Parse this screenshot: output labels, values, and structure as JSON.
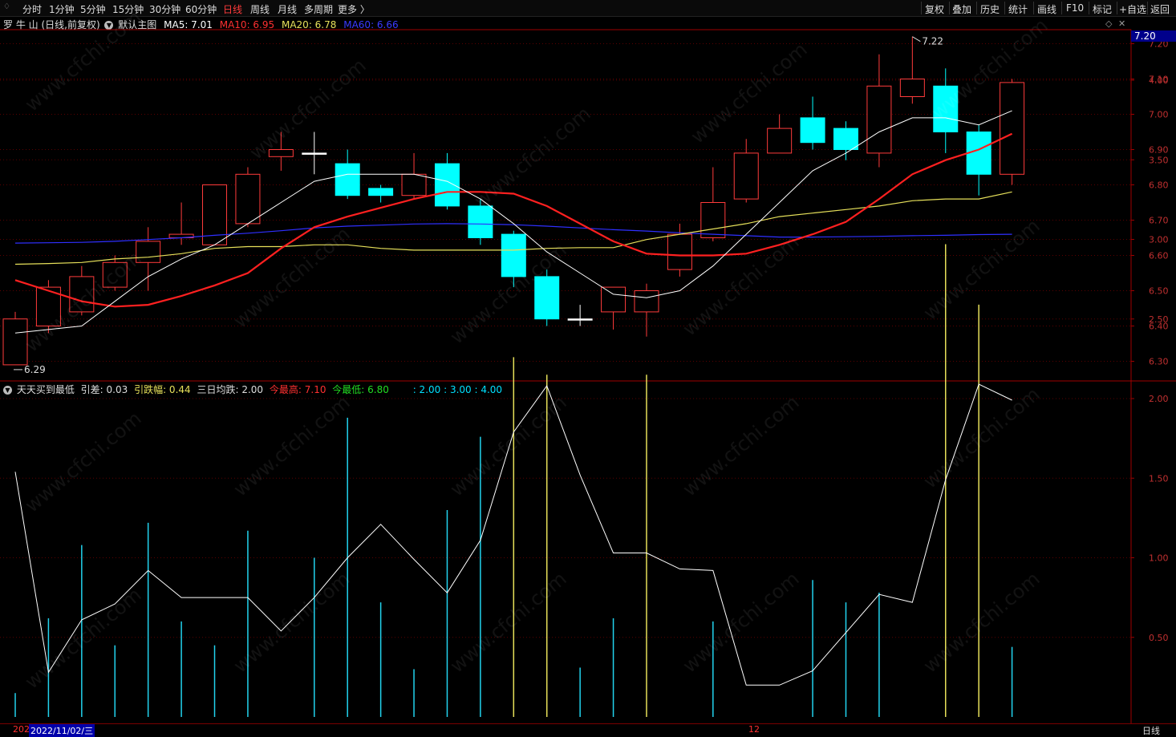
{
  "toolbar": {
    "left_items": [
      "分时",
      "1分钟",
      "5分钟",
      "15分钟",
      "30分钟",
      "60分钟",
      "日线",
      "周线",
      "月线",
      "多周期",
      "更多 〉"
    ],
    "active_index": 6,
    "right_items": [
      "复权",
      "叠加",
      "历史",
      "统计",
      "画线",
      "F10",
      "标记",
      "+自选",
      "返回"
    ]
  },
  "main_header": {
    "stock": "罗 牛 山 (日线,前复权)",
    "indicator": "默认主图",
    "ma5": "MA5: 7.01",
    "ma10": "MA10: 6.95",
    "ma20": "MA20: 6.78",
    "ma60": "MA60: 6.66"
  },
  "sub_header": {
    "name": "天天买到最低",
    "diff": "引差: 0.03",
    "amp": "引跌幅: 0.44",
    "avg": "三日均跌: 2.00",
    "high": "今最高: 7.10",
    "low": "今最低: 6.80",
    "levels": ": 2.00 : 3.00 : 4.00"
  },
  "price_marker": "7.20",
  "annotations": {
    "high": "7.22",
    "low": "6.29"
  },
  "bottom": {
    "date_left": "202",
    "date": "2022/11/02/三",
    "month_tick": "12",
    "period": "日线"
  },
  "colors": {
    "up": "#ff3b3b",
    "down": "#00ffff",
    "ma5": "#ffffff",
    "ma10": "#ff2020",
    "ma20": "#e6e05a",
    "ma60": "#2f2fff",
    "axis": "#a00000"
  },
  "chart_data": [
    {
      "type": "candlestick",
      "title": "罗牛山 日线",
      "yaxis_ticks": [
        "7.20",
        "7.10",
        "7.00",
        "6.90",
        "6.80",
        "6.70",
        "6.60",
        "6.50",
        "6.40",
        "6.30"
      ],
      "ylim": [
        6.27,
        7.24
      ],
      "candles": [
        {
          "o": 6.29,
          "c": 6.42,
          "h": 6.44,
          "l": 6.29
        },
        {
          "o": 6.4,
          "c": 6.51,
          "h": 6.53,
          "l": 6.38
        },
        {
          "o": 6.44,
          "c": 6.54,
          "h": 6.57,
          "l": 6.43
        },
        {
          "o": 6.51,
          "c": 6.58,
          "h": 6.6,
          "l": 6.5
        },
        {
          "o": 6.58,
          "c": 6.64,
          "h": 6.68,
          "l": 6.5
        },
        {
          "o": 6.65,
          "c": 6.66,
          "h": 6.75,
          "l": 6.63
        },
        {
          "o": 6.63,
          "c": 6.8,
          "h": 6.8,
          "l": 6.63
        },
        {
          "o": 6.69,
          "c": 6.83,
          "h": 6.85,
          "l": 6.68
        },
        {
          "o": 6.88,
          "c": 6.9,
          "h": 6.95,
          "l": 6.84
        },
        {
          "o": 6.89,
          "c": 6.89,
          "h": 6.95,
          "l": 6.83
        },
        {
          "o": 6.86,
          "c": 6.77,
          "h": 6.9,
          "l": 6.76
        },
        {
          "o": 6.79,
          "c": 6.77,
          "h": 6.8,
          "l": 6.75
        },
        {
          "o": 6.77,
          "c": 6.83,
          "h": 6.89,
          "l": 6.76
        },
        {
          "o": 6.86,
          "c": 6.74,
          "h": 6.89,
          "l": 6.73
        },
        {
          "o": 6.74,
          "c": 6.65,
          "h": 6.76,
          "l": 6.63
        },
        {
          "o": 6.66,
          "c": 6.54,
          "h": 6.67,
          "l": 6.51
        },
        {
          "o": 6.54,
          "c": 6.42,
          "h": 6.56,
          "l": 6.4
        },
        {
          "o": 6.42,
          "c": 6.42,
          "h": 6.46,
          "l": 6.4
        },
        {
          "o": 6.44,
          "c": 6.51,
          "h": 6.51,
          "l": 6.39
        },
        {
          "o": 6.44,
          "c": 6.5,
          "h": 6.52,
          "l": 6.37
        },
        {
          "o": 6.56,
          "c": 6.66,
          "h": 6.69,
          "l": 6.54
        },
        {
          "o": 6.65,
          "c": 6.75,
          "h": 6.85,
          "l": 6.64
        },
        {
          "o": 6.76,
          "c": 6.89,
          "h": 6.93,
          "l": 6.75
        },
        {
          "o": 6.89,
          "c": 6.96,
          "h": 7.0,
          "l": 6.89
        },
        {
          "o": 6.99,
          "c": 6.92,
          "h": 7.05,
          "l": 6.9
        },
        {
          "o": 6.96,
          "c": 6.9,
          "h": 6.98,
          "l": 6.87
        },
        {
          "o": 6.89,
          "c": 7.08,
          "h": 7.17,
          "l": 6.85
        },
        {
          "o": 7.05,
          "c": 7.1,
          "h": 7.22,
          "l": 7.03
        },
        {
          "o": 7.08,
          "c": 6.95,
          "h": 7.13,
          "l": 6.89
        },
        {
          "o": 6.95,
          "c": 6.83,
          "h": 6.97,
          "l": 6.77
        },
        {
          "o": 6.83,
          "c": 7.09,
          "h": 7.1,
          "l": 6.8
        }
      ],
      "ma5": [
        6.38,
        6.39,
        6.4,
        6.47,
        6.54,
        6.59,
        6.63,
        6.69,
        6.75,
        6.81,
        6.83,
        6.83,
        6.83,
        6.81,
        6.76,
        6.69,
        6.61,
        6.55,
        6.49,
        6.48,
        6.5,
        6.57,
        6.66,
        6.75,
        6.84,
        6.89,
        6.95,
        6.99,
        6.99,
        6.97,
        7.01
      ],
      "ma10": [
        6.53,
        6.5,
        6.47,
        6.455,
        6.46,
        6.485,
        6.515,
        6.55,
        6.62,
        6.68,
        6.71,
        6.735,
        6.76,
        6.78,
        6.78,
        6.775,
        6.74,
        6.69,
        6.64,
        6.605,
        6.6,
        6.6,
        6.605,
        6.63,
        6.66,
        6.695,
        6.76,
        6.83,
        6.87,
        6.9,
        6.945
      ],
      "ma20": [
        6.575,
        6.577,
        6.58,
        6.59,
        6.595,
        6.605,
        6.62,
        6.625,
        6.625,
        6.63,
        6.63,
        6.62,
        6.615,
        6.615,
        6.615,
        6.615,
        6.62,
        6.622,
        6.622,
        6.645,
        6.66,
        6.675,
        6.69,
        6.71,
        6.72,
        6.73,
        6.74,
        6.755,
        6.76,
        6.76,
        6.78
      ],
      "ma60": [
        6.635,
        6.636,
        6.637,
        6.64,
        6.645,
        6.65,
        6.657,
        6.663,
        6.67,
        6.678,
        6.683,
        6.686,
        6.689,
        6.69,
        6.689,
        6.687,
        6.683,
        6.678,
        6.673,
        6.669,
        6.664,
        6.66,
        6.656,
        6.652,
        6.652,
        6.653,
        6.654,
        6.656,
        6.657,
        6.659,
        6.66
      ]
    },
    {
      "type": "bar",
      "title": "天天买到最低",
      "yaxis_ticks": [
        "4.00",
        "3.50",
        "3.00",
        "2.50",
        "2.00",
        "1.50",
        "1.00",
        "0.50"
      ],
      "ylim": [
        0,
        4.2
      ],
      "bars": [
        0.15,
        0.62,
        1.08,
        0.45,
        1.22,
        0.6,
        0.45,
        1.17,
        0,
        1.0,
        1.88,
        0.72,
        0.3,
        1.3,
        1.76,
        2.26,
        2.15,
        0.31,
        0.62,
        2.15,
        0,
        0.6,
        0,
        0,
        0.86,
        0.72,
        0.78,
        0,
        2.97,
        2.59,
        0.44
      ],
      "bar_colors": [
        "c",
        "c",
        "c",
        "c",
        "c",
        "c",
        "c",
        "c",
        "c",
        "c",
        "c",
        "c",
        "c",
        "c",
        "c",
        "y",
        "y",
        "c",
        "c",
        "y",
        "c",
        "c",
        "c",
        "c",
        "c",
        "c",
        "c",
        "c",
        "y",
        "y",
        "c"
      ],
      "line": [
        1.54,
        0.28,
        0.61,
        0.71,
        0.92,
        0.75,
        0.75,
        0.75,
        0.54,
        0.75,
        1.0,
        1.21,
        0.99,
        0.78,
        1.11,
        1.79,
        2.08,
        1.52,
        1.03,
        1.03,
        0.93,
        0.92,
        0.2,
        0.2,
        0.29,
        0.53,
        0.77,
        0.72,
        1.49,
        2.09,
        1.99
      ]
    }
  ]
}
